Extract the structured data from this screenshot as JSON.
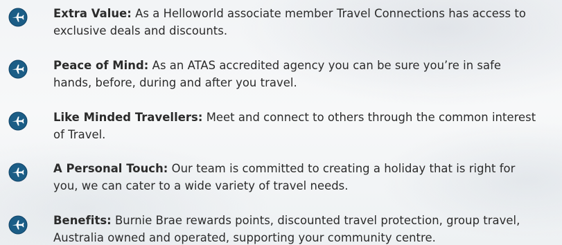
{
  "icon_name": "airplane-badge-icon",
  "accent_color": "#1b5d86",
  "items": [
    {
      "heading": "Extra Value:",
      "line1_rest": " As a Helloworld associate member Travel Connections has access to",
      "line2": "exclusive deals and discounts."
    },
    {
      "heading": "Peace of Mind:",
      "line1_rest": " As an ATAS accredited agency you can be sure you’re in safe",
      "line2": "hands, before, during and after you travel."
    },
    {
      "heading": "Like Minded Travellers:",
      "line1_rest": " Meet and connect to others through the common interest",
      "line2": "of Travel."
    },
    {
      "heading": "A Personal Touch:",
      "line1_rest": " Our team is committed to creating a holiday that is right for",
      "line2": "you, we can cater to a wide variety of travel needs."
    },
    {
      "heading": "Benefits:",
      "line1_rest": " Burnie Brae rewards points, discounted travel protection,  group travel,",
      "line2": "Australia owned and operated, supporting your community centre."
    }
  ]
}
